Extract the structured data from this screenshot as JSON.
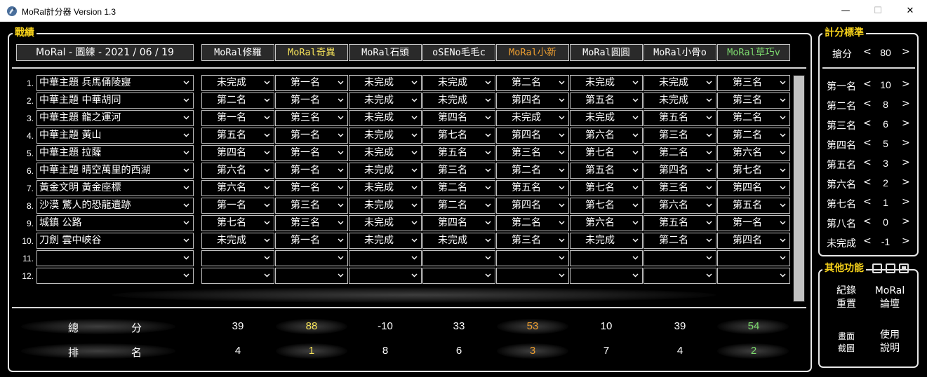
{
  "window": {
    "title": "MoRal計分器 Version 1.3",
    "min_glyph": "—",
    "max_glyph": "☐",
    "close_glyph": "✕"
  },
  "record": {
    "group_title": "戰績",
    "date_label": "MoRal - 圖練 - 2021 / 06 / 19",
    "add_row_label": "+"
  },
  "colors": {
    "gold": "#f7e45a",
    "orange": "#f0a030",
    "green": "#7ddb6e",
    "white": "#ffffff",
    "group_title": "#f7d21a"
  },
  "players": [
    {
      "name": "MoRal修羅",
      "color": "#ffffff"
    },
    {
      "name": "MoRal奇異",
      "color": "#f7e45a"
    },
    {
      "name": "MoRal石頭",
      "color": "#ffffff"
    },
    {
      "name": "oSENo毛毛c",
      "color": "#ffffff"
    },
    {
      "name": "MoRal小新",
      "color": "#f0a030"
    },
    {
      "name": "MoRal圓圓",
      "color": "#ffffff"
    },
    {
      "name": "MoRal小骨o",
      "color": "#ffffff"
    },
    {
      "name": "MoRal草巧v",
      "color": "#7ddb6e"
    }
  ],
  "rows": [
    {
      "num": "1.",
      "map": "中華主題 兵馬俑陵寢",
      "results": [
        "未完成",
        "第一名",
        "未完成",
        "未完成",
        "第二名",
        "未完成",
        "未完成",
        "第三名"
      ]
    },
    {
      "num": "2.",
      "map": "中華主題 中華胡同",
      "results": [
        "第二名",
        "第一名",
        "未完成",
        "未完成",
        "第四名",
        "第五名",
        "未完成",
        "第三名"
      ]
    },
    {
      "num": "3.",
      "map": "中華主題 龍之運河",
      "results": [
        "第一名",
        "第三名",
        "未完成",
        "第四名",
        "未完成",
        "未完成",
        "第五名",
        "第二名"
      ]
    },
    {
      "num": "4.",
      "map": "中華主題 黃山",
      "results": [
        "第五名",
        "第一名",
        "未完成",
        "第七名",
        "第四名",
        "第六名",
        "第三名",
        "第二名"
      ]
    },
    {
      "num": "5.",
      "map": "中華主題 拉薩",
      "results": [
        "第四名",
        "第一名",
        "未完成",
        "第五名",
        "第三名",
        "第七名",
        "第二名",
        "第六名"
      ]
    },
    {
      "num": "6.",
      "map": "中華主題 晴空萬里的西湖",
      "results": [
        "第六名",
        "第一名",
        "未完成",
        "第三名",
        "第二名",
        "第五名",
        "第四名",
        "第七名"
      ]
    },
    {
      "num": "7.",
      "map": "黃金文明 黃金座標",
      "results": [
        "第六名",
        "第一名",
        "未完成",
        "第二名",
        "第五名",
        "第七名",
        "第三名",
        "第四名"
      ]
    },
    {
      "num": "8.",
      "map": "沙漠 驚人的恐龍遺跡",
      "results": [
        "第一名",
        "第三名",
        "未完成",
        "第二名",
        "第四名",
        "第七名",
        "第六名",
        "第五名"
      ]
    },
    {
      "num": "9.",
      "map": "城鎮 公路",
      "results": [
        "第七名",
        "第三名",
        "未完成",
        "第四名",
        "第二名",
        "第六名",
        "第五名",
        "第一名"
      ]
    },
    {
      "num": "10.",
      "map": "刀劍 雲中峽谷",
      "results": [
        "未完成",
        "第一名",
        "未完成",
        "未完成",
        "第三名",
        "未完成",
        "第二名",
        "第四名"
      ]
    },
    {
      "num": "11.",
      "map": "",
      "results": [
        "",
        "",
        "",
        "",
        "",
        "",
        "",
        ""
      ]
    },
    {
      "num": "12.",
      "map": "",
      "results": [
        "",
        "",
        "",
        "",
        "",
        "",
        "",
        ""
      ]
    }
  ],
  "summary": {
    "total_label_a": "總",
    "total_label_b": "分",
    "rank_label_a": "排",
    "rank_label_b": "名",
    "totals": [
      "39",
      "88",
      "-10",
      "33",
      "53",
      "10",
      "39",
      "54"
    ],
    "ranks": [
      "4",
      "1",
      "8",
      "6",
      "3",
      "7",
      "4",
      "2"
    ]
  },
  "scoring": {
    "group_title": "計分標準",
    "left_arrow": "<",
    "right_arrow": ">",
    "grab": {
      "label": "搶分",
      "value": "80"
    },
    "places": [
      {
        "label": "第一名",
        "value": "10"
      },
      {
        "label": "第二名",
        "value": "8"
      },
      {
        "label": "第三名",
        "value": "6"
      },
      {
        "label": "第四名",
        "value": "5"
      },
      {
        "label": "第五名",
        "value": "3"
      },
      {
        "label": "第六名",
        "value": "2"
      },
      {
        "label": "第七名",
        "value": "1"
      },
      {
        "label": "第八名",
        "value": "0"
      },
      {
        "label": "未完成",
        "value": "-1"
      }
    ]
  },
  "functions": {
    "group_title": "其他功能",
    "reset_line1": "紀錄",
    "reset_line2": "重置",
    "forum_line1": "MoRal",
    "forum_line2": "論壇",
    "screenshot_line1": "畫面",
    "screenshot_line2": "截圖",
    "help_line1": "使用",
    "help_line2": "說明"
  }
}
